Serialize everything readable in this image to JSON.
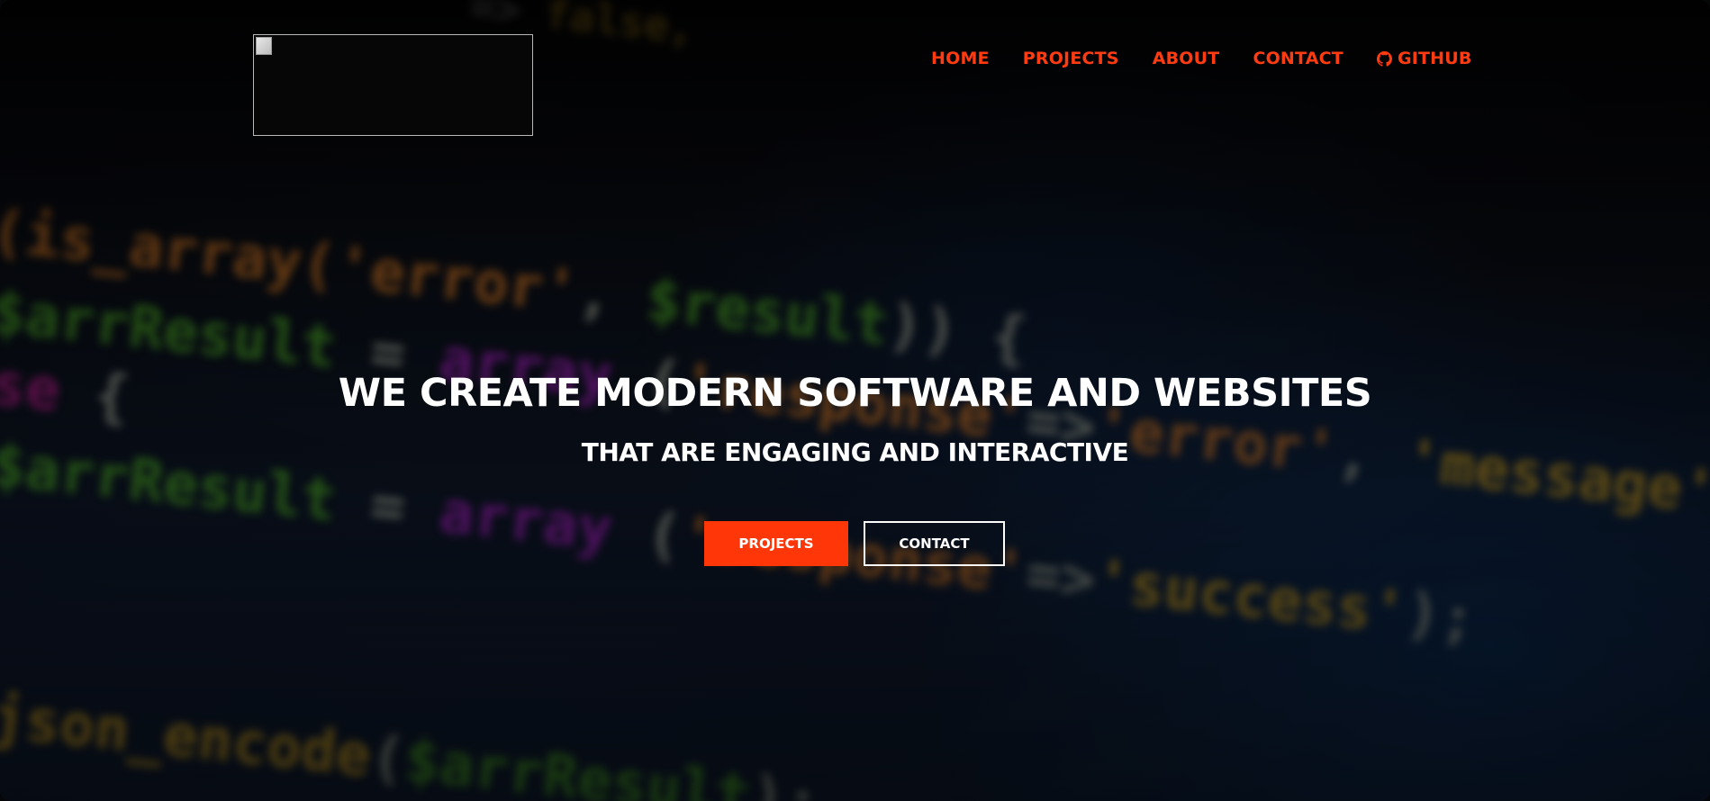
{
  "header": {
    "logo_alt": "",
    "nav": [
      {
        "label": "HOME"
      },
      {
        "label": "PROJECTS"
      },
      {
        "label": "ABOUT"
      },
      {
        "label": "CONTACT"
      },
      {
        "label": "GITHUB",
        "icon": "github-icon"
      }
    ]
  },
  "hero": {
    "headline": "WE CREATE MODERN SOFTWARE AND WEBSITES",
    "subheadline": "THAT ARE ENGAGING AND INTERACTIVE",
    "primary_button": "PROJECTS",
    "secondary_button": "CONTACT"
  },
  "colors": {
    "accent": "#ff3608",
    "nav_link": "#ff3b12",
    "text": "#ffffff",
    "background": "#050608"
  }
}
